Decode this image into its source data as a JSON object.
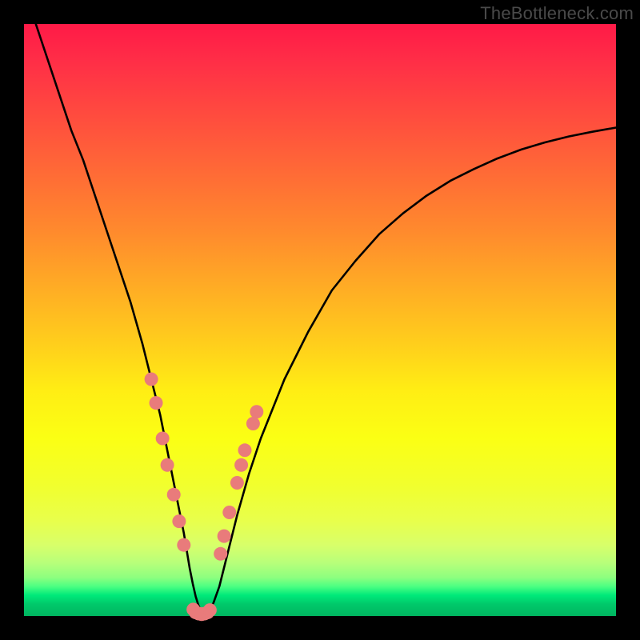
{
  "watermark": "TheBottleneck.com",
  "colors": {
    "curve_stroke": "#000000",
    "marker_fill": "#e97b7b",
    "marker_stroke": "#d06464"
  },
  "chart_data": {
    "type": "line",
    "title": "",
    "xlabel": "",
    "ylabel": "",
    "xlim": [
      0,
      100
    ],
    "ylim": [
      0,
      100
    ],
    "series": [
      {
        "name": "bottleneck-curve",
        "x": [
          2,
          4,
          6,
          8,
          10,
          12,
          14,
          16,
          18,
          20,
          21,
          22,
          23,
          24,
          25,
          26,
          27,
          27.5,
          28,
          28.5,
          29,
          29.5,
          30,
          30.5,
          31,
          32,
          33,
          34,
          35,
          36,
          38,
          40,
          44,
          48,
          52,
          56,
          60,
          64,
          68,
          72,
          76,
          80,
          84,
          88,
          92,
          96,
          100
        ],
        "y": [
          100,
          94,
          88,
          82,
          77,
          71,
          65,
          59,
          53,
          46,
          42,
          38,
          34,
          29,
          24,
          19,
          14,
          11,
          8,
          5.5,
          3.3,
          1.7,
          0.8,
          0.5,
          0.8,
          2.2,
          5,
          9,
          13,
          17,
          24,
          30,
          40,
          48,
          55,
          60,
          64.5,
          68,
          71,
          73.5,
          75.5,
          77.3,
          78.8,
          80,
          81,
          81.8,
          82.5
        ]
      }
    ],
    "markers": {
      "name": "highlighted-points",
      "points": [
        {
          "x": 21.5,
          "y": 40
        },
        {
          "x": 22.3,
          "y": 36
        },
        {
          "x": 23.4,
          "y": 30
        },
        {
          "x": 24.2,
          "y": 25.5
        },
        {
          "x": 25.3,
          "y": 20.5
        },
        {
          "x": 26.2,
          "y": 16
        },
        {
          "x": 27.0,
          "y": 12
        },
        {
          "x": 28.6,
          "y": 1.1
        },
        {
          "x": 29.0,
          "y": 0.6
        },
        {
          "x": 29.5,
          "y": 0.4
        },
        {
          "x": 30.0,
          "y": 0.3
        },
        {
          "x": 30.5,
          "y": 0.4
        },
        {
          "x": 31.0,
          "y": 0.6
        },
        {
          "x": 31.4,
          "y": 1.0
        },
        {
          "x": 33.2,
          "y": 10.5
        },
        {
          "x": 33.8,
          "y": 13.5
        },
        {
          "x": 34.7,
          "y": 17.5
        },
        {
          "x": 36.0,
          "y": 22.5
        },
        {
          "x": 36.7,
          "y": 25.5
        },
        {
          "x": 37.3,
          "y": 28
        },
        {
          "x": 38.7,
          "y": 32.5
        },
        {
          "x": 39.3,
          "y": 34.5
        }
      ]
    }
  }
}
